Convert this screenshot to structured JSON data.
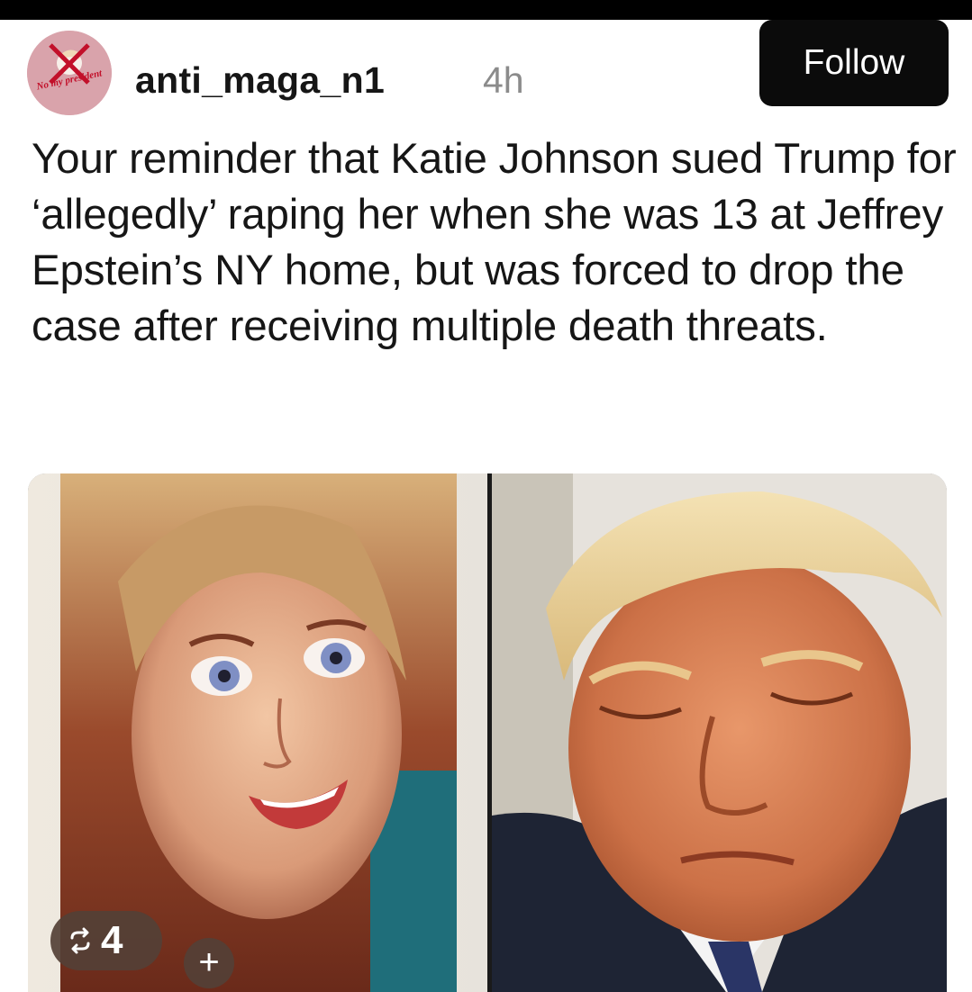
{
  "post": {
    "username": "anti_maga_n1",
    "time_ago": "4h",
    "follow_label": "Follow",
    "avatar_text": "No my president",
    "text": "Your reminder that Katie Johnson sued Trump for ‘allegedly’ raping her when she was 13 at Jeffrey Epstein’s NY home, but was forced to drop the case after receiving multiple death threats."
  },
  "media": {
    "repost_count": "4",
    "add_label": "+"
  },
  "colors": {
    "follow_bg": "#0b0b0b",
    "avatar_bg": "#d9a3ab",
    "badge_bg": "#544036"
  }
}
